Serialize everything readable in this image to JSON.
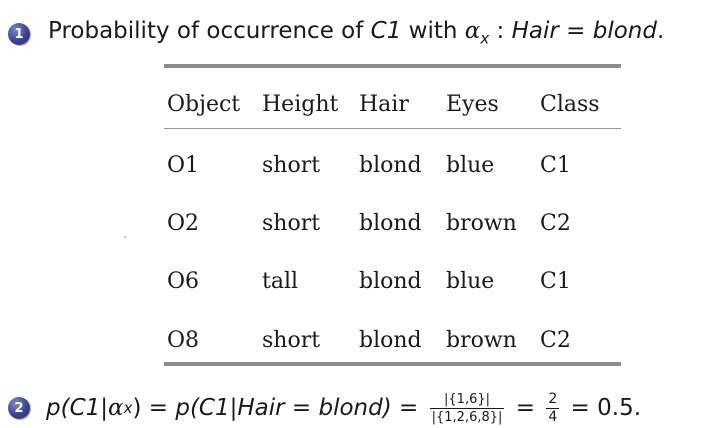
{
  "badges": [
    "1",
    "2"
  ],
  "heading": {
    "prefix": "Probability of occurrence of ",
    "class_label": "C1",
    "with": " with ",
    "alpha": "α",
    "alpha_sub": "x",
    "colon": " : ",
    "attr": "Hair",
    "equals": " = ",
    "value": "blond",
    "end": "."
  },
  "table": {
    "columns": [
      "Object",
      "Height",
      "Hair",
      "Eyes",
      "Class"
    ],
    "rows": [
      [
        "O1",
        "short",
        "blond",
        "blue",
        "C1"
      ],
      [
        "O2",
        "short",
        "blond",
        "brown",
        "C2"
      ],
      [
        "O6",
        "tall",
        "blond",
        "blue",
        "C1"
      ],
      [
        "O8",
        "short",
        "blond",
        "brown",
        "C2"
      ]
    ]
  },
  "formula": {
    "lhs_open": "p(C1|",
    "alpha": "α",
    "alpha_sub": "x",
    "lhs_close": ")",
    "eq1": " = ",
    "mid": "p(C1|Hair = blond)",
    "eq2": " = ",
    "frac1_num": "|{1,6}|",
    "frac1_den": "|{1,2,6,8}|",
    "eq3": " = ",
    "frac2_num": "2",
    "frac2_den": "4",
    "eq4": " = ",
    "result": "0.5."
  }
}
